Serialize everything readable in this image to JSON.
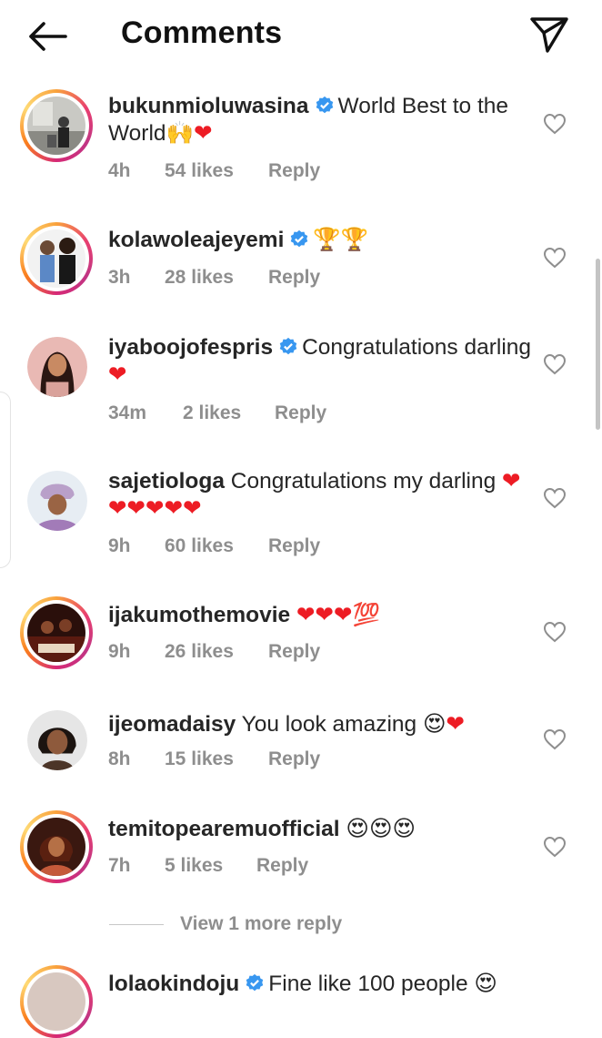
{
  "header": {
    "title": "Comments",
    "back_icon": "arrow-left-icon",
    "share_icon": "paper-plane-icon"
  },
  "comments": [
    {
      "username": "bukunmioluwasina",
      "verified": true,
      "text": "World Best to the World",
      "emoji": "🙌",
      "hearts": "❤",
      "time": "4h",
      "likes": "54 likes",
      "reply": "Reply"
    },
    {
      "username": "kolawoleajeyemi",
      "verified": true,
      "text": "",
      "emoji": "🏆🏆",
      "hearts": "",
      "time": "3h",
      "likes": "28 likes",
      "reply": "Reply"
    },
    {
      "username": "iyaboojofespris",
      "verified": true,
      "text": "Congratulations darling",
      "emoji": "",
      "hearts": "❤",
      "time": "34m",
      "likes": "2 likes",
      "reply": "Reply"
    },
    {
      "username": "sajetiologa",
      "verified": false,
      "text": "Congratulations my darling",
      "emoji": "",
      "hearts": "❤❤❤❤❤❤",
      "time": "9h",
      "likes": "60 likes",
      "reply": "Reply"
    },
    {
      "username": "ijakumothemovie",
      "verified": false,
      "text": "",
      "emoji": "💯",
      "hearts": "❤❤❤",
      "time": "9h",
      "likes": "26 likes",
      "reply": "Reply"
    },
    {
      "username": "ijeomadaisy",
      "verified": false,
      "text": "You look amazing",
      "emoji": "😍",
      "hearts": "❤",
      "time": "8h",
      "likes": "15 likes",
      "reply": "Reply"
    },
    {
      "username": "temitopearemuofficial",
      "verified": false,
      "text": "",
      "emoji": "😍😍😍",
      "hearts": "",
      "time": "7h",
      "likes": "5 likes",
      "reply": "Reply"
    },
    {
      "username": "lolaokindoju",
      "verified": true,
      "text": "Fine like 100 people",
      "emoji": "😍",
      "hearts": "",
      "time": "",
      "likes": "",
      "reply": ""
    }
  ],
  "view_more": "View 1 more reply",
  "colors": {
    "verified": "#3897f0",
    "heart": "#ed1c24",
    "meta": "#8e8e8e",
    "text": "#262626"
  }
}
